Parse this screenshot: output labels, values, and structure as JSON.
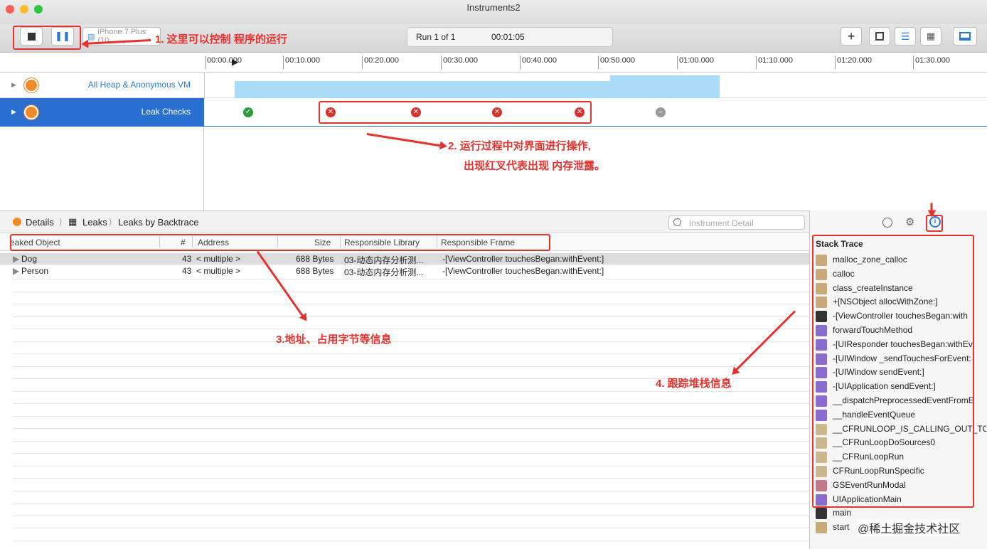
{
  "window": {
    "title": "Instruments2"
  },
  "toolbar": {
    "device_label": "iPhone 7 Plus (10...",
    "run_label": "Run 1 of 1",
    "elapsed_time": "00:01:05",
    "add_label": "+"
  },
  "ruler": {
    "ticks": [
      "00:00.000",
      "00:10.000",
      "00:20.000",
      "00:30.000",
      "00:40.000",
      "00:50.000",
      "01:00.000",
      "01:10.000",
      "01:20.000",
      "01:30.000"
    ]
  },
  "tracks": [
    {
      "name": "All Heap & Anonymous VM",
      "selected": false
    },
    {
      "name": "Leak Checks",
      "selected": true
    }
  ],
  "leak_checks": {
    "green": 1,
    "red": 4,
    "gray": 1
  },
  "annotations": {
    "a1": "1. 这里可以控制 程序的运行",
    "a2_line1": "2. 运行过程中对界面进行操作,",
    "a2_line2": "出现红叉代表出现 内存泄露。",
    "a3": "3.地址、占用字节等信息",
    "a4": "4. 跟踪堆栈信息"
  },
  "breadcrumb": {
    "details": "Details",
    "leaks": "Leaks",
    "backtrace": "Leaks by Backtrace"
  },
  "detail_search": {
    "placeholder": "Instrument Detail"
  },
  "table": {
    "columns": {
      "object": "eaked Object",
      "count": "#",
      "address": "Address",
      "size": "Size",
      "library": "Responsible Library",
      "frame": "Responsible Frame"
    },
    "rows": [
      {
        "object": "Dog",
        "count": "43",
        "address": "< multiple >",
        "size": "688 Bytes",
        "library": "03-动态内存分析测...",
        "frame": "-[ViewController touchesBegan:withEvent:]"
      },
      {
        "object": "Person",
        "count": "43",
        "address": "< multiple >",
        "size": "688 Bytes",
        "library": "03-动态内存分析测...",
        "frame": "-[ViewController touchesBegan:withEvent:]"
      }
    ]
  },
  "stack_trace": {
    "title": "Stack Trace",
    "frames": [
      {
        "label": "malloc_zone_calloc",
        "kind": "sys"
      },
      {
        "label": "calloc",
        "kind": "sys"
      },
      {
        "label": "class_createInstance",
        "kind": "sys"
      },
      {
        "label": "+[NSObject allocWithZone:]",
        "kind": "sys"
      },
      {
        "label": "-[ViewController touchesBegan:with",
        "kind": "user"
      },
      {
        "label": "forwardTouchMethod",
        "kind": "uikit"
      },
      {
        "label": "-[UIResponder touchesBegan:withEv",
        "kind": "uikit"
      },
      {
        "label": "-[UIWindow _sendTouchesForEvent:",
        "kind": "uikit"
      },
      {
        "label": "-[UIWindow sendEvent:]",
        "kind": "uikit"
      },
      {
        "label": "-[UIApplication sendEvent:]",
        "kind": "uikit"
      },
      {
        "label": "__dispatchPreprocessedEventFromE",
        "kind": "uikit"
      },
      {
        "label": "__handleEventQueue",
        "kind": "uikit"
      },
      {
        "label": "__CFRUNLOOP_IS_CALLING_OUT_TO",
        "kind": "cf"
      },
      {
        "label": "__CFRunLoopDoSources0",
        "kind": "cf"
      },
      {
        "label": "__CFRunLoopRun",
        "kind": "cf"
      },
      {
        "label": "CFRunLoopRunSpecific",
        "kind": "cf"
      },
      {
        "label": "GSEventRunModal",
        "kind": "gs"
      },
      {
        "label": "UIApplicationMain",
        "kind": "uikit"
      },
      {
        "label": "main",
        "kind": "user"
      },
      {
        "label": "start",
        "kind": "sys"
      }
    ]
  },
  "watermark": {
    "text": "@稀土掘金技术社区"
  },
  "colors": {
    "accent": "#2a7ad6",
    "annotation": "#e5322d",
    "heap": "#a9dcf6",
    "green": "#2e9a3e",
    "red": "#d9322e"
  }
}
